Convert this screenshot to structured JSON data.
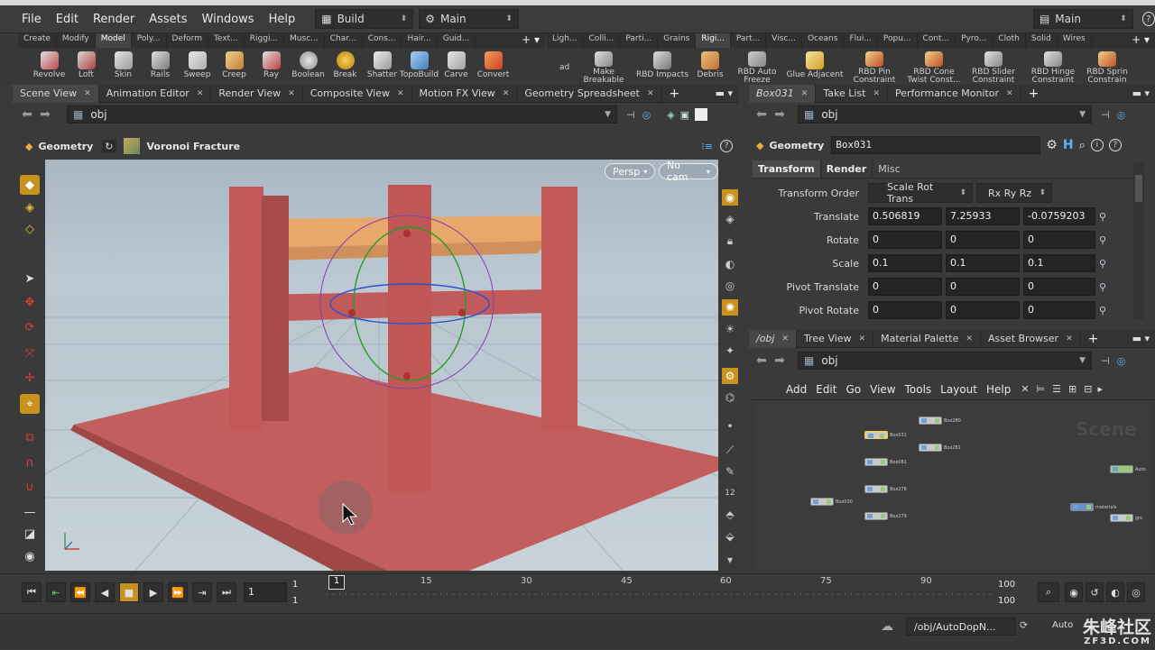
{
  "menubar": {
    "items": [
      "File",
      "Edit",
      "Render",
      "Assets",
      "Windows",
      "Help"
    ],
    "desktop": "Build",
    "context": "Main",
    "right_context": "Main"
  },
  "shelf_left": {
    "tabs": [
      "Create",
      "Modify",
      "Model",
      "Poly...",
      "Deform",
      "Text...",
      "Riggi...",
      "Musc...",
      "Char...",
      "Cons...",
      "Hair...",
      "Guid..."
    ],
    "active_tab": "Model",
    "tools": [
      "Revolve",
      "Loft",
      "Skin",
      "Rails",
      "Sweep",
      "Creep",
      "Ray",
      "Boolean",
      "Break",
      "Shatter",
      "TopoBuild",
      "Carve",
      "Convert"
    ]
  },
  "shelf_right": {
    "tabs": [
      "Ligh...",
      "Colli...",
      "Parti...",
      "Grains",
      "Rigi...",
      "Part...",
      "Visc...",
      "Oceans",
      "Flui...",
      "Popu...",
      "Cont...",
      "Pyro...",
      "Cloth",
      "Solid",
      "Wires"
    ],
    "active_tab": "Rigi...",
    "tools": [
      "Make Breakable",
      "RBD Impacts",
      "Debris",
      "RBD Auto Freeze",
      "Glue Adjacent",
      "RBD Pin Constraint",
      "RBD Cone Twist Const...",
      "RBD Slider Constraint",
      "RBD Hinge Constraint",
      "RBD Sprin Constrain"
    ],
    "partial_label": "ad"
  },
  "viewer_tabs": [
    "Scene View",
    "Animation Editor",
    "Render View",
    "Composite View",
    "Motion FX View",
    "Geometry Spreadsheet"
  ],
  "viewer_path": "obj",
  "viewer_header": {
    "context": "Geometry",
    "node": "Voronoi Fracture"
  },
  "viewport": {
    "camera_menu": "Persp",
    "cam": "No cam"
  },
  "param_tabs": [
    "Box031",
    "Take List",
    "Performance Monitor"
  ],
  "param_path": "obj",
  "param_header": {
    "context": "Geometry",
    "node_name": "Box031"
  },
  "param_subtabs": [
    "Transform",
    "Render",
    "Misc"
  ],
  "params": {
    "transform_order_label": "Transform Order",
    "transform_order": "Scale Rot Trans",
    "rot_order": "Rx Ry Rz",
    "rows": [
      {
        "label": "Translate",
        "v": [
          "0.506819",
          "7.25933",
          "-0.0759203"
        ]
      },
      {
        "label": "Rotate",
        "v": [
          "0",
          "0",
          "0"
        ]
      },
      {
        "label": "Scale",
        "v": [
          "0.1",
          "0.1",
          "0.1"
        ]
      },
      {
        "label": "Pivot Translate",
        "v": [
          "0",
          "0",
          "0"
        ]
      },
      {
        "label": "Pivot Rotate",
        "v": [
          "0",
          "0",
          "0"
        ]
      }
    ]
  },
  "network_tabs": [
    "/obj",
    "Tree View",
    "Material Palette",
    "Asset Browser"
  ],
  "network_path": "obj",
  "network_menu": [
    "Add",
    "Edit",
    "Go",
    "View",
    "Tools",
    "Layout",
    "Help"
  ],
  "network_watermark": "Scene",
  "nodes": [
    {
      "name": "Box031"
    },
    {
      "name": "Box280"
    },
    {
      "name": "Box281"
    },
    {
      "name": "Box081"
    },
    {
      "name": "Box278"
    },
    {
      "name": "Box030"
    },
    {
      "name": "Box279"
    },
    {
      "name": "materials"
    },
    {
      "name": "Auto"
    },
    {
      "name": "gro"
    }
  ],
  "timeline": {
    "current_frame": "1",
    "start": "1",
    "start2": "1",
    "end": "100",
    "end2": "100",
    "ticks": [
      "1",
      "15",
      "30",
      "45",
      "60",
      "75",
      "90"
    ],
    "marker": "1"
  },
  "status": {
    "path": "/obj/AutoDopN...",
    "auto": "Auto",
    "watermark_cn": "朱峰社区",
    "watermark_en": "ZF3D.COM"
  }
}
